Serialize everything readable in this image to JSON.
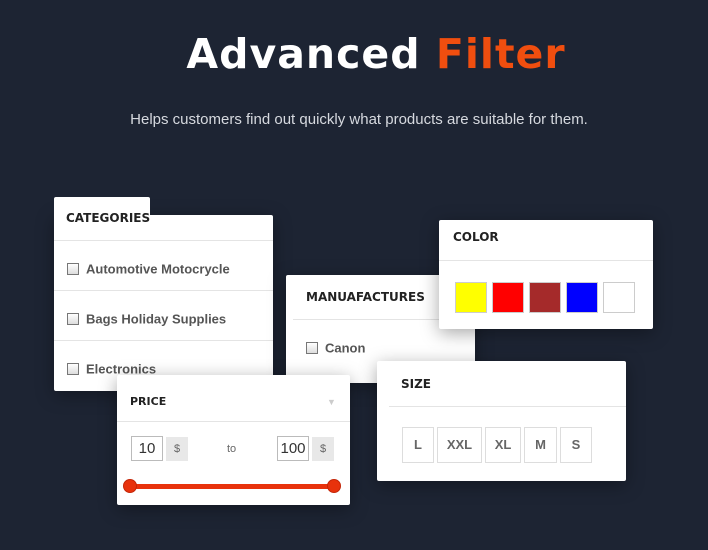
{
  "hero": {
    "title_main": "Advanced",
    "title_accent": "Filter",
    "subtitle": "Helps customers find out quickly what products are suitable for them."
  },
  "categories": {
    "title": "CATEGORIES",
    "items": [
      "Automotive Motocrycle",
      "Bags Holiday Supplies",
      "Electronics"
    ]
  },
  "manufactures": {
    "title": "MANUAFACTURES",
    "items": [
      "Canon"
    ]
  },
  "color": {
    "title": "COLOR",
    "swatches": [
      "#ffff00",
      "#ff0000",
      "#a52a2a",
      "#0000ff",
      "#ffffff"
    ]
  },
  "price": {
    "title": "PRICE",
    "min": "10",
    "max": "100",
    "currency": "$",
    "separator": "to",
    "accent": "#e8320c"
  },
  "size": {
    "title": "SIZE",
    "options": [
      "L",
      "XXL",
      "XL",
      "M",
      "S"
    ]
  },
  "colors": {
    "background": "#1d2433",
    "accent": "#f04e0f"
  }
}
